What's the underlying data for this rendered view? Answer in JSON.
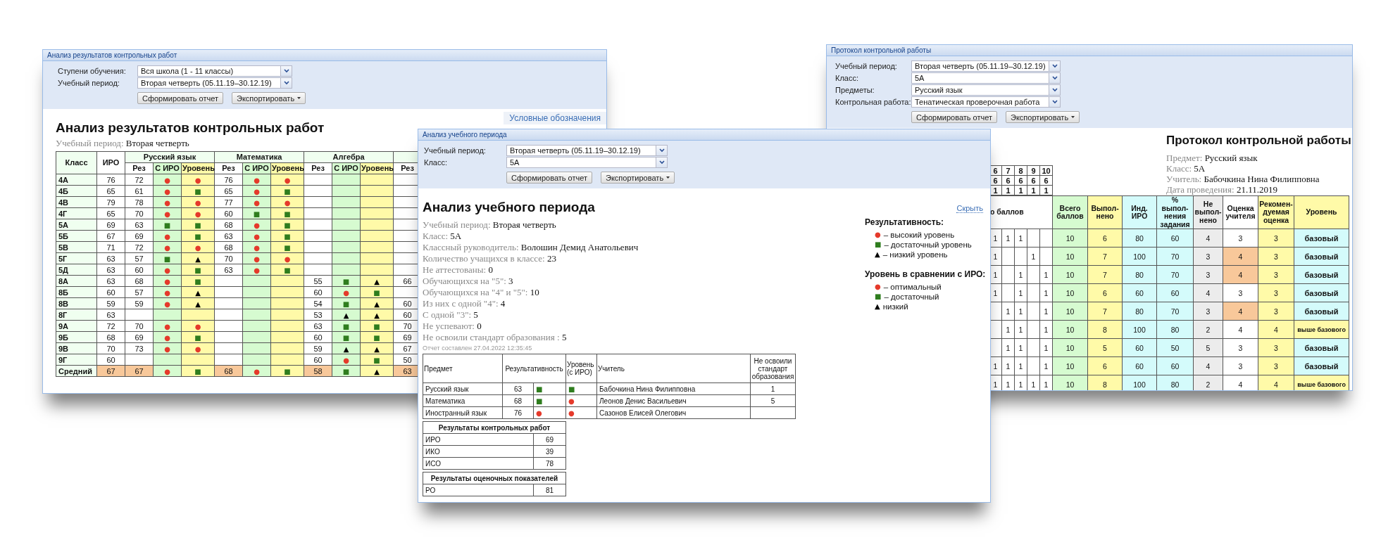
{
  "windows": [
    {
      "kind": "results",
      "title": "Анализ результатов контрольных работ",
      "filters": [
        {
          "label": "Ступени обучения:",
          "value": "Вся школа (1 - 11 классы)"
        },
        {
          "label": "Учебный период:",
          "value": "Вторая четверть (05.11.19–30.12.19)"
        }
      ],
      "buttons": [
        {
          "label": "Сформировать отчет",
          "kind": "submit"
        },
        {
          "label": "Экспортировать",
          "kind": "menu"
        }
      ],
      "legend_link": "Условные обозначения",
      "heading": "Анализ результатов контрольных работ",
      "period": {
        "label": "Учебный период:",
        "value": "Вторая четверть"
      },
      "table": {
        "class_header": "Класс",
        "iro_header": "ИРО",
        "subjects": [
          {
            "name": "Русский язык",
            "columns": [
              {
                "label": "Рез",
                "kind": "result"
              },
              {
                "label": "С ИРО",
                "kind": "vs_iro"
              },
              {
                "label": "Уровень",
                "kind": "level"
              }
            ]
          },
          {
            "name": "Математика",
            "columns": [
              {
                "label": "Рез",
                "kind": "result"
              },
              {
                "label": "С ИРО",
                "kind": "vs_iro"
              },
              {
                "label": "Уровень",
                "kind": "level"
              }
            ]
          },
          {
            "name": "Алгебра",
            "columns": [
              {
                "label": "Рез",
                "kind": "result"
              },
              {
                "label": "С ИРО",
                "kind": "vs_iro"
              },
              {
                "label": "Уровень",
                "kind": "level"
              }
            ]
          },
          {
            "columns": [
              {
                "label": "Рез",
                "kind": "result"
              }
            ]
          }
        ],
        "rows": [
          {
            "kind": "class",
            "class": "4А",
            "iro": "76",
            "russian_language": {
              "result": "72",
              "vs_iro": {
                "symbol": "●",
                "color": "#e53a2b"
              },
              "level": {
                "symbol": "●",
                "color": "#e53a2b"
              }
            },
            "mathematics": {
              "result": "76",
              "vs_iro": {
                "symbol": "●",
                "color": "#e53a2b"
              },
              "level": {
                "symbol": "●",
                "color": "#e53a2b"
              }
            }
          },
          {
            "kind": "class",
            "class": "4Б",
            "iro": "65",
            "russian_language": {
              "result": "61",
              "vs_iro": {
                "symbol": "●",
                "color": "#e53a2b"
              },
              "level": {
                "symbol": "■",
                "color": "#2f7d1e"
              }
            },
            "mathematics": {
              "result": "65",
              "vs_iro": {
                "symbol": "●",
                "color": "#e53a2b"
              },
              "level": {
                "symbol": "■",
                "color": "#2f7d1e"
              }
            }
          },
          {
            "kind": "class",
            "class": "4В",
            "iro": "79",
            "russian_language": {
              "result": "78",
              "vs_iro": {
                "symbol": "●",
                "color": "#e53a2b"
              },
              "level": {
                "symbol": "●",
                "color": "#e53a2b"
              }
            },
            "mathematics": {
              "result": "77",
              "vs_iro": {
                "symbol": "●",
                "color": "#e53a2b"
              },
              "level": {
                "symbol": "●",
                "color": "#e53a2b"
              }
            }
          },
          {
            "kind": "class",
            "class": "4Г",
            "iro": "65",
            "russian_language": {
              "result": "70",
              "vs_iro": {
                "symbol": "●",
                "color": "#e53a2b"
              },
              "level": {
                "symbol": "●",
                "color": "#e53a2b"
              }
            },
            "mathematics": {
              "result": "60",
              "vs_iro": {
                "symbol": "■",
                "color": "#2f7d1e"
              },
              "level": {
                "symbol": "■",
                "color": "#2f7d1e"
              }
            }
          },
          {
            "kind": "class",
            "class": "5А",
            "iro": "69",
            "russian_language": {
              "result": "63",
              "vs_iro": {
                "symbol": "■",
                "color": "#2f7d1e"
              },
              "level": {
                "symbol": "■",
                "color": "#2f7d1e"
              }
            },
            "mathematics": {
              "result": "68",
              "vs_iro": {
                "symbol": "●",
                "color": "#e53a2b"
              },
              "level": {
                "symbol": "■",
                "color": "#2f7d1e"
              }
            }
          },
          {
            "kind": "class",
            "class": "5Б",
            "iro": "67",
            "russian_language": {
              "result": "69",
              "vs_iro": {
                "symbol": "●",
                "color": "#e53a2b"
              },
              "level": {
                "symbol": "■",
                "color": "#2f7d1e"
              }
            },
            "mathematics": {
              "result": "63",
              "vs_iro": {
                "symbol": "●",
                "color": "#e53a2b"
              },
              "level": {
                "symbol": "■",
                "color": "#2f7d1e"
              }
            }
          },
          {
            "kind": "class",
            "class": "5В",
            "iro": "71",
            "russian_language": {
              "result": "72",
              "vs_iro": {
                "symbol": "●",
                "color": "#e53a2b"
              },
              "level": {
                "symbol": "●",
                "color": "#e53a2b"
              }
            },
            "mathematics": {
              "result": "68",
              "vs_iro": {
                "symbol": "●",
                "color": "#e53a2b"
              },
              "level": {
                "symbol": "■",
                "color": "#2f7d1e"
              }
            }
          },
          {
            "kind": "class",
            "class": "5Г",
            "iro": "63",
            "russian_language": {
              "result": "57",
              "vs_iro": {
                "symbol": "■",
                "color": "#2f7d1e"
              },
              "level": {
                "symbol": "▲",
                "color": "#000000"
              }
            },
            "mathematics": {
              "result": "70",
              "vs_iro": {
                "symbol": "●",
                "color": "#e53a2b"
              },
              "level": {
                "symbol": "●",
                "color": "#e53a2b"
              }
            }
          },
          {
            "kind": "class",
            "class": "5Д",
            "iro": "63",
            "russian_language": {
              "result": "60",
              "vs_iro": {
                "symbol": "●",
                "color": "#e53a2b"
              },
              "level": {
                "symbol": "■",
                "color": "#2f7d1e"
              }
            },
            "mathematics": {
              "result": "63",
              "vs_iro": {
                "symbol": "●",
                "color": "#e53a2b"
              },
              "level": {
                "symbol": "■",
                "color": "#2f7d1e"
              }
            }
          },
          {
            "kind": "class",
            "class": "8А",
            "iro": "63",
            "russian_language": {
              "result": "68",
              "vs_iro": {
                "symbol": "●",
                "color": "#e53a2b"
              },
              "level": {
                "symbol": "■",
                "color": "#2f7d1e"
              }
            },
            "algebra": {
              "result": "55",
              "vs_iro": {
                "symbol": "■",
                "color": "#2f7d1e"
              },
              "level": {
                "symbol": "▲",
                "color": "#000000"
              }
            },
            "column_4": {
              "result": "66"
            }
          },
          {
            "kind": "class",
            "class": "8Б",
            "iro": "60",
            "russian_language": {
              "result": "57",
              "vs_iro": {
                "symbol": "●",
                "color": "#e53a2b"
              },
              "level": {
                "symbol": "▲",
                "color": "#000000"
              }
            },
            "algebra": {
              "result": "60",
              "vs_iro": {
                "symbol": "●",
                "color": "#e53a2b"
              },
              "level": {
                "symbol": "■",
                "color": "#2f7d1e"
              }
            }
          },
          {
            "kind": "class",
            "class": "8В",
            "iro": "59",
            "russian_language": {
              "result": "59",
              "vs_iro": {
                "symbol": "●",
                "color": "#e53a2b"
              },
              "level": {
                "symbol": "▲",
                "color": "#000000"
              }
            },
            "algebra": {
              "result": "54",
              "vs_iro": {
                "symbol": "■",
                "color": "#2f7d1e"
              },
              "level": {
                "symbol": "▲",
                "color": "#000000"
              }
            },
            "column_4": {
              "result": "60"
            }
          },
          {
            "kind": "class",
            "class": "8Г",
            "iro": "63",
            "algebra": {
              "result": "53",
              "vs_iro": {
                "symbol": "▲",
                "color": "#000000"
              },
              "level": {
                "symbol": "▲",
                "color": "#000000"
              }
            },
            "column_4": {
              "result": "60"
            }
          },
          {
            "kind": "class",
            "class": "9А",
            "iro": "72",
            "russian_language": {
              "result": "70",
              "vs_iro": {
                "symbol": "●",
                "color": "#e53a2b"
              },
              "level": {
                "symbol": "●",
                "color": "#e53a2b"
              }
            },
            "algebra": {
              "result": "63",
              "vs_iro": {
                "symbol": "■",
                "color": "#2f7d1e"
              },
              "level": {
                "symbol": "■",
                "color": "#2f7d1e"
              }
            },
            "column_4": {
              "result": "70"
            }
          },
          {
            "kind": "class",
            "class": "9Б",
            "iro": "68",
            "russian_language": {
              "result": "69",
              "vs_iro": {
                "symbol": "●",
                "color": "#e53a2b"
              },
              "level": {
                "symbol": "■",
                "color": "#2f7d1e"
              }
            },
            "algebra": {
              "result": "60",
              "vs_iro": {
                "symbol": "■",
                "color": "#2f7d1e"
              },
              "level": {
                "symbol": "■",
                "color": "#2f7d1e"
              }
            },
            "column_4": {
              "result": "69"
            }
          },
          {
            "kind": "class",
            "class": "9В",
            "iro": "70",
            "russian_language": {
              "result": "73",
              "vs_iro": {
                "symbol": "●",
                "color": "#e53a2b"
              },
              "level": {
                "symbol": "●",
                "color": "#e53a2b"
              }
            },
            "algebra": {
              "result": "59",
              "vs_iro": {
                "symbol": "▲",
                "color": "#000000"
              },
              "level": {
                "symbol": "▲",
                "color": "#000000"
              }
            },
            "column_4": {
              "result": "67"
            }
          },
          {
            "kind": "class",
            "class": "9Г",
            "iro": "60",
            "algebra": {
              "result": "60",
              "vs_iro": {
                "symbol": "●",
                "color": "#e53a2b"
              },
              "level": {
                "symbol": "■",
                "color": "#2f7d1e"
              }
            },
            "column_4": {
              "result": "50"
            }
          },
          {
            "kind": "average",
            "class": "Средний",
            "iro": "67",
            "russian_language": {
              "result": "67",
              "vs_iro": {
                "symbol": "●",
                "color": "#e53a2b"
              },
              "level": {
                "symbol": "■",
                "color": "#2f7d1e"
              }
            },
            "mathematics": {
              "result": "68",
              "vs_iro": {
                "symbol": "●",
                "color": "#e53a2b"
              },
              "level": {
                "symbol": "■",
                "color": "#2f7d1e"
              }
            },
            "algebra": {
              "result": "58",
              "vs_iro": {
                "symbol": "■",
                "color": "#2f7d1e"
              },
              "level": {
                "symbol": "▲",
                "color": "#000000"
              }
            },
            "column_4": {
              "result": "63"
            }
          }
        ]
      }
    },
    {
      "kind": "period",
      "title": "Анализ учебного периода",
      "filters": [
        {
          "label": "Учебный период:",
          "value": "Вторая четверть (05.11.19–30.12.19)"
        },
        {
          "label": "Класс:",
          "value": "5А"
        }
      ],
      "buttons": [
        {
          "label": "Сформировать отчет",
          "kind": "submit"
        },
        {
          "label": "Экспортировать",
          "kind": "menu"
        }
      ],
      "heading": "Анализ учебного периода",
      "hide_link": "Скрыть",
      "info": [
        {
          "label": "Учебный период:",
          "value": "Вторая четверть"
        },
        {
          "label": "Класс:",
          "value": "5А"
        },
        {
          "label": "Классный руководитель:",
          "value": "Волошин Демид Анатольевич"
        },
        {
          "label": "Количество учащихся в классе:",
          "value": "23"
        },
        {
          "label": "Не аттестованы:",
          "value": "0"
        },
        {
          "label": "Обучающихся на \"5\":",
          "value": "3"
        },
        {
          "label": "Обучающихся на \"4\" и \"5\":",
          "value": "10"
        },
        {
          "label": "Из них с одной \"4\":",
          "value": "4"
        },
        {
          "label": "С одной \"3\":",
          "value": "5"
        },
        {
          "label": "Не успевают:",
          "value": "0"
        },
        {
          "label": "Не освоили стандарт образования :",
          "value": "5"
        }
      ],
      "report_time": "Отчет составлен 27.04.2022 12:35:45",
      "legend": [
        {
          "title": "Результативность:",
          "items": [
            {
              "mark": {
                "symbol": "●",
                "color": "#e53a2b"
              },
              "label": "– высокий уровень"
            },
            {
              "mark": {
                "symbol": "■",
                "color": "#2f7d1e"
              },
              "label": "– достаточный уровень"
            },
            {
              "mark": {
                "symbol": "▲",
                "color": "#000000"
              },
              "label": "– низкий уровень"
            }
          ]
        },
        {
          "title": "Уровень в сравнении с ИРО:",
          "items": [
            {
              "mark": {
                "symbol": "●",
                "color": "#e53a2b"
              },
              "label": "– оптимальный"
            },
            {
              "mark": {
                "symbol": "■",
                "color": "#2f7d1e"
              },
              "label": "– достаточный"
            },
            {
              "mark": {
                "symbol": "▲",
                "color": "#000000"
              },
              "label": "низкий"
            }
          ]
        }
      ],
      "subjects_table": {
        "columns": [
          "Предмет",
          "Результативность",
          "Уровень (с ИРО)",
          "Учитель",
          "Не освоили стандарт образования"
        ],
        "rows": [
          {
            "subject": "Русский язык",
            "result": "63",
            "result_mark": {
              "symbol": "■",
              "color": "#2f7d1e"
            },
            "iro_mark": {
              "symbol": "■",
              "color": "#2f7d1e"
            },
            "teacher": "Бабочкина Нина Филипповна",
            "not_mastered": "1"
          },
          {
            "subject": "Математика",
            "result": "68",
            "result_mark": {
              "symbol": "■",
              "color": "#2f7d1e"
            },
            "iro_mark": {
              "symbol": "●",
              "color": "#e53a2b"
            },
            "teacher": "Леонов Денис Васильевич",
            "not_mastered": "5"
          },
          {
            "subject": "Иностранный язык",
            "result": "76",
            "result_mark": {
              "symbol": "●",
              "color": "#e53a2b"
            },
            "iro_mark": {
              "symbol": "●",
              "color": "#e53a2b"
            },
            "teacher": "Сазонов Елисей Олегович"
          }
        ]
      },
      "summary_tables": [
        {
          "title": "Результаты контрольных работ",
          "rows": [
            {
              "label": "ИРО",
              "value": "69"
            },
            {
              "label": "ИКО",
              "value": "39"
            },
            {
              "label": "ИСО",
              "value": "78"
            }
          ]
        },
        {
          "title": "Результаты оценочных показателей",
          "rows": [
            {
              "label": "РО",
              "value": "81"
            }
          ]
        }
      ]
    },
    {
      "kind": "protocol",
      "title": "Протокол контрольной работы",
      "filters": [
        {
          "label": "Учебный период:",
          "value": "Вторая четверть (05.11.19–30.12.19)"
        },
        {
          "label": "Класс:",
          "value": "5А"
        },
        {
          "label": "Предметы:",
          "value": "Русский язык"
        },
        {
          "label": "Контрольная работа:",
          "value": "Тенатическая проверочная работа"
        }
      ],
      "buttons": [
        {
          "label": "Сформировать отчет",
          "kind": "submit"
        },
        {
          "label": "Экспортировать",
          "kind": "menu"
        }
      ],
      "heading": "Протокол контрольной работы",
      "info": [
        {
          "label": "Предмет:",
          "value": "Русский язык"
        },
        {
          "label": "Класс:",
          "value": "5А"
        },
        {
          "label": "Учитель:",
          "value": "Бабочкина Нина Филипповна"
        },
        {
          "label": "Дата проведения:",
          "value": "21.11.2019"
        }
      ],
      "items_grid": [
        [
          "6",
          "7",
          "8",
          "9",
          "10"
        ],
        [
          "6",
          "6",
          "6",
          "6",
          "6"
        ],
        [
          "1",
          "1",
          "1",
          "1",
          "1"
        ]
      ],
      "table": {
        "columns": [
          {
            "label": "о баллов",
            "kind": "items"
          },
          {
            "label": "Всего баллов",
            "kind": "total"
          },
          {
            "label": "Выпол-нено",
            "kind": "done"
          },
          {
            "label": "Инд. ИРО",
            "kind": "iro"
          },
          {
            "label": "% выпол-нения задания",
            "kind": "percent"
          },
          {
            "label": "Не выпол-нено",
            "kind": "not_done"
          },
          {
            "label": "Оценка учителя",
            "kind": "grade"
          },
          {
            "label": "Рекомен-дуемая оценка",
            "kind": "recommended"
          },
          {
            "label": "Уровень",
            "kind": "level"
          }
        ],
        "rows": [
          {
            "items": {
              "column_1": "1",
              "column_2": "1",
              "column_3": "1"
            },
            "total": "10",
            "done": "6",
            "iro": "80",
            "percent": "60",
            "not_done": "4",
            "grade": "3",
            "grade_differs": false,
            "recommended": "3",
            "level": "базовый",
            "kind": "base"
          },
          {
            "items": {
              "column_1": "1",
              "column_4": "1"
            },
            "total": "10",
            "done": "7",
            "iro": "100",
            "percent": "70",
            "not_done": "3",
            "grade": "4",
            "grade_differs": true,
            "recommended": "3",
            "level": "базовый",
            "kind": "base"
          },
          {
            "items": {
              "column_1": "1",
              "column_3": "1",
              "column_5": "1"
            },
            "total": "10",
            "done": "7",
            "iro": "80",
            "percent": "70",
            "not_done": "3",
            "grade": "4",
            "grade_differs": true,
            "recommended": "3",
            "level": "базовый",
            "kind": "base"
          },
          {
            "items": {
              "column_1": "1",
              "column_3": "1",
              "column_5": "1"
            },
            "total": "10",
            "done": "6",
            "iro": "60",
            "percent": "60",
            "not_done": "4",
            "grade": "3",
            "grade_differs": false,
            "recommended": "3",
            "level": "базовый",
            "kind": "base"
          },
          {
            "items": {
              "column_2": "1",
              "column_3": "1",
              "column_5": "1"
            },
            "total": "10",
            "done": "7",
            "iro": "80",
            "percent": "70",
            "not_done": "3",
            "grade": "4",
            "grade_differs": true,
            "recommended": "3",
            "level": "базовый",
            "kind": "base"
          },
          {
            "items": {
              "column_2": "1",
              "column_3": "1",
              "column_5": "1"
            },
            "total": "10",
            "done": "8",
            "iro": "100",
            "percent": "80",
            "not_done": "2",
            "grade": "4",
            "grade_differs": false,
            "recommended": "4",
            "level": "выше базового",
            "kind": "above"
          },
          {
            "items": {
              "column_2": "1",
              "column_3": "1",
              "column_5": "1"
            },
            "total": "10",
            "done": "5",
            "iro": "60",
            "percent": "50",
            "not_done": "5",
            "grade": "3",
            "grade_differs": false,
            "recommended": "3",
            "level": "базовый",
            "kind": "base"
          },
          {
            "items": {
              "column_1": "1",
              "column_2": "1",
              "column_3": "1",
              "column_5": "1"
            },
            "total": "10",
            "done": "6",
            "iro": "60",
            "percent": "60",
            "not_done": "4",
            "grade": "3",
            "grade_differs": false,
            "recommended": "3",
            "level": "базовый",
            "kind": "base"
          },
          {
            "items": {
              "column_1": "1",
              "column_2": "1",
              "column_3": "1",
              "column_4": "1",
              "column_5": "1"
            },
            "total": "10",
            "done": "8",
            "iro": "100",
            "percent": "80",
            "not_done": "2",
            "grade": "4",
            "grade_differs": false,
            "recommended": "4",
            "level": "выше базового",
            "kind": "above"
          }
        ]
      }
    }
  ]
}
